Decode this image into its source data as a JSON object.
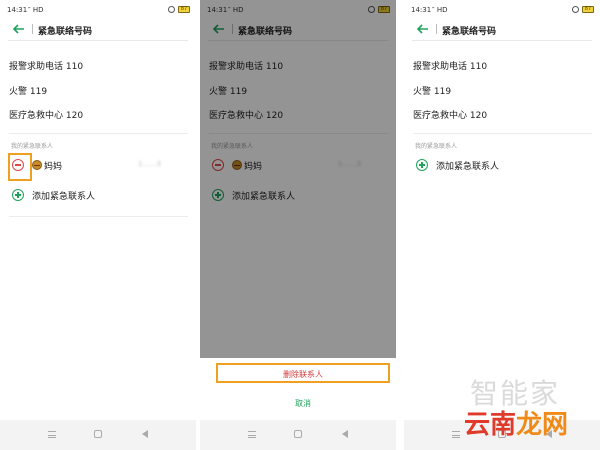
{
  "status_bar": {
    "time": "14:31",
    "signal": "″ HD",
    "battery_left": "87",
    "battery_middle": "87"
  },
  "header": {
    "title": "紧急联络号码"
  },
  "emergency_numbers": [
    {
      "label": "报警求助电话 110"
    },
    {
      "label": "火警 119"
    },
    {
      "label": "医疗急救中心 120"
    }
  ],
  "contacts_section": {
    "label": "我的紧急联系人"
  },
  "contact": {
    "name": "妈妈",
    "phone": "1……3"
  },
  "add_contact": {
    "label": "添加紧急联系人"
  },
  "action_sheet": {
    "delete_label": "删除联系人",
    "cancel_label": "取消"
  },
  "watermark": {
    "line1": "智能家",
    "line2_a": "云南",
    "line2_b": "龙网"
  },
  "colors": {
    "accent_green": "#1fa35a",
    "danger_red": "#e04848",
    "highlight_orange": "#f0a020"
  }
}
